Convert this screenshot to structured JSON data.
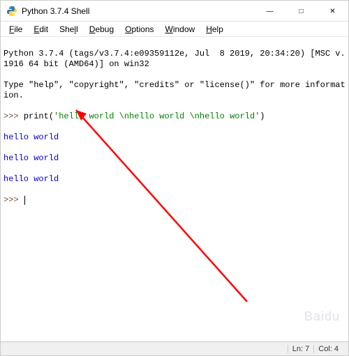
{
  "window": {
    "title": "Python 3.7.4 Shell"
  },
  "menu": {
    "file": "File",
    "edit": "Edit",
    "shell": "Shell",
    "debug": "Debug",
    "options": "Options",
    "window": "Window",
    "help": "Help"
  },
  "shell": {
    "banner_line1": "Python 3.7.4 (tags/v3.7.4:e09359112e, Jul  8 2019, 20:34:20) [MSC v.1916 64 bit (AMD64)] on win32",
    "banner_line2": "Type \"help\", \"copyright\", \"credits\" or \"license()\" for more information.",
    "prompt": ">>> ",
    "input_call": "print(",
    "input_string": "'hello world \\nhello world \\nhello world'",
    "input_close": ")",
    "output1": "hello world ",
    "output2": "hello world ",
    "output3": "hello world",
    "prompt2": ">>> "
  },
  "status": {
    "ln": "Ln: 7",
    "col": "Col: 4"
  },
  "watermark": "Baidu"
}
